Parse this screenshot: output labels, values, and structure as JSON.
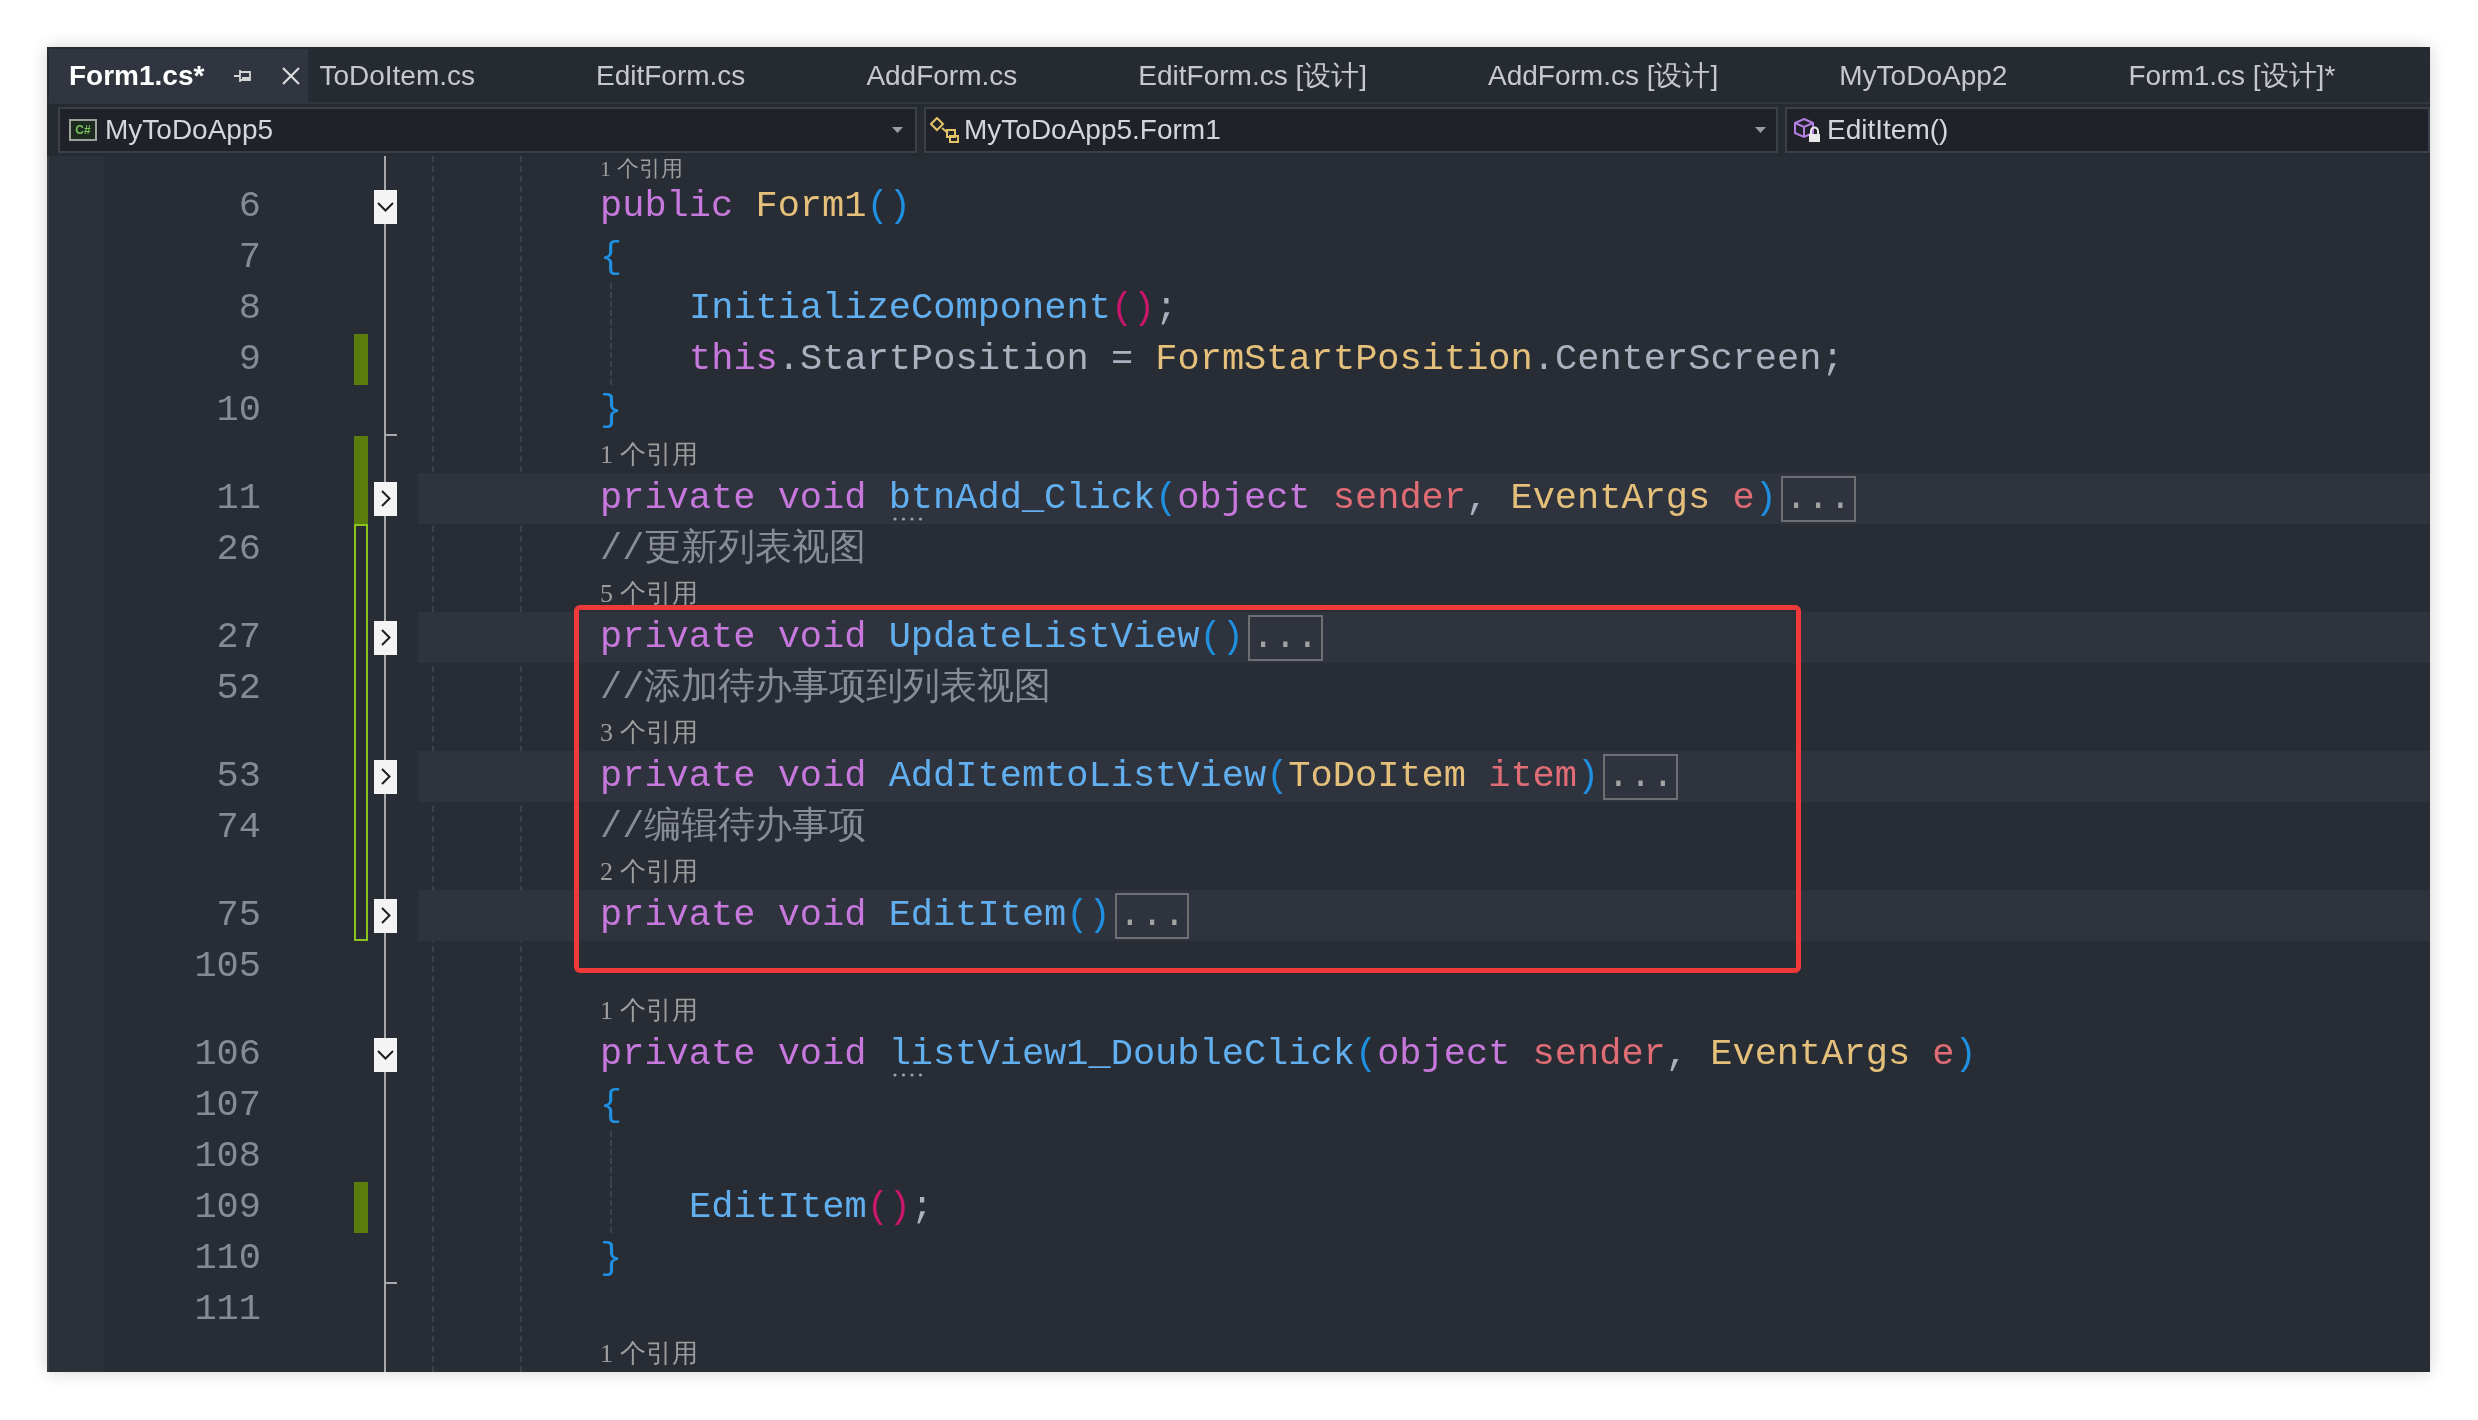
{
  "tabs": [
    {
      "label": "Form1.cs*",
      "selected": true
    },
    {
      "label": "ToDoItem.cs",
      "selected": false
    },
    {
      "label": "EditForm.cs",
      "selected": false
    },
    {
      "label": "AddForm.cs",
      "selected": false
    },
    {
      "label": "EditForm.cs [设计]",
      "selected": false
    },
    {
      "label": "AddForm.cs [设计]",
      "selected": false
    },
    {
      "label": "MyToDoApp2",
      "selected": false
    },
    {
      "label": "Form1.cs [设计]*",
      "selected": false
    }
  ],
  "navigation": [
    {
      "kind": "project",
      "badge": "C#",
      "label": "MyToDoApp5"
    },
    {
      "kind": "class",
      "label": "MyToDoApp5.Form1"
    },
    {
      "kind": "member",
      "label": "EditItem()"
    }
  ],
  "lines": [
    {
      "kind": "lens",
      "text": "1 个引用"
    },
    {
      "kind": "code",
      "number": "6",
      "expanded": true,
      "tokens": [
        {
          "kind": "keyword",
          "text": "public "
        },
        {
          "kind": "type",
          "text": "Form1"
        },
        {
          "kind": "bracket",
          "text": "()"
        }
      ]
    },
    {
      "kind": "code",
      "number": "7",
      "tokens": [
        {
          "kind": "bracket",
          "text": "{"
        }
      ]
    },
    {
      "kind": "code",
      "number": "8",
      "indented": true,
      "tokens": [
        {
          "kind": "method",
          "text": "InitializeComponent"
        },
        {
          "kind": "bracket2",
          "text": "()"
        },
        {
          "kind": "plain",
          "text": ";"
        }
      ]
    },
    {
      "kind": "code",
      "number": "9",
      "indented": true,
      "changed": true,
      "tokens": [
        {
          "kind": "keyword",
          "text": "this"
        },
        {
          "kind": "plain",
          "text": ".StartPosition = "
        },
        {
          "kind": "type",
          "text": "FormStartPosition"
        },
        {
          "kind": "plain",
          "text": ".CenterScreen;"
        }
      ]
    },
    {
      "kind": "code",
      "number": "10",
      "fold_end": true,
      "tokens": [
        {
          "kind": "bracket",
          "text": "}"
        }
      ]
    },
    {
      "kind": "lens",
      "text": "1 个引用",
      "changed": true
    },
    {
      "kind": "code",
      "number": "11",
      "expanded": false,
      "changed": true,
      "tokens": [
        {
          "kind": "keyword",
          "text": "private void "
        },
        {
          "kind": "method",
          "text": "btnAdd_Click",
          "hint": true
        },
        {
          "kind": "bracket",
          "text": "("
        },
        {
          "kind": "keyword",
          "text": "object "
        },
        {
          "kind": "param",
          "text": "sender"
        },
        {
          "kind": "plain",
          "text": ", "
        },
        {
          "kind": "type",
          "text": "EventArgs "
        },
        {
          "kind": "param",
          "text": "e"
        },
        {
          "kind": "bracket",
          "text": ")"
        },
        {
          "kind": "ellipsis",
          "text": "..."
        }
      ]
    },
    {
      "kind": "code",
      "number": "26",
      "outlined_change": true,
      "tokens": [
        {
          "kind": "comment",
          "text": "//更新列表视图"
        }
      ]
    },
    {
      "kind": "lens",
      "text": "5 个引用",
      "outlined_change": true
    },
    {
      "kind": "annotation",
      "lines": [
        {
          "kind": "code",
          "number": "27",
          "expanded": false,
          "outlined_change": true,
          "tokens": [
            {
              "kind": "keyword",
              "text": "private void "
            },
            {
              "kind": "method",
              "text": "UpdateListView"
            },
            {
              "kind": "bracket",
              "text": "()"
            },
            {
              "kind": "ellipsis",
              "text": "..."
            }
          ]
        },
        {
          "kind": "code",
          "number": "52",
          "outlined_change": true,
          "tokens": [
            {
              "kind": "comment",
              "text": "//添加待办事项到列表视图"
            }
          ]
        },
        {
          "kind": "lens",
          "text": "3 个引用",
          "outlined_change": true
        },
        {
          "kind": "code",
          "number": "53",
          "expanded": false,
          "outlined_change": true,
          "tokens": [
            {
              "kind": "keyword",
              "text": "private void "
            },
            {
              "kind": "method",
              "text": "AddItemtoListView"
            },
            {
              "kind": "bracket",
              "text": "("
            },
            {
              "kind": "type",
              "text": "ToDoItem "
            },
            {
              "kind": "param",
              "text": "item"
            },
            {
              "kind": "bracket",
              "text": ")"
            },
            {
              "kind": "ellipsis",
              "text": "..."
            }
          ]
        },
        {
          "kind": "code",
          "number": "74",
          "outlined_change": true,
          "tokens": [
            {
              "kind": "comment",
              "text": "//编辑待办事项"
            }
          ]
        },
        {
          "kind": "lens",
          "text": "2 个引用",
          "outlined_change": true
        },
        {
          "kind": "code",
          "number": "75",
          "expanded": false,
          "outlined_change": true,
          "tokens": [
            {
              "kind": "keyword",
              "text": "private void "
            },
            {
              "kind": "method",
              "text": "EditItem"
            },
            {
              "kind": "bracket",
              "text": "()"
            },
            {
              "kind": "ellipsis",
              "text": "..."
            }
          ]
        }
      ]
    },
    {
      "kind": "code",
      "number": "105"
    },
    {
      "kind": "lens",
      "text": "1 个引用"
    },
    {
      "kind": "code",
      "number": "106",
      "expanded": true,
      "tokens": [
        {
          "kind": "keyword",
          "text": "private void "
        },
        {
          "kind": "method",
          "text": "listView1_DoubleClick",
          "hint": true
        },
        {
          "kind": "bracket",
          "text": "("
        },
        {
          "kind": "keyword",
          "text": "object "
        },
        {
          "kind": "param",
          "text": "sender"
        },
        {
          "kind": "plain",
          "text": ", "
        },
        {
          "kind": "type",
          "text": "EventArgs "
        },
        {
          "kind": "param",
          "text": "e"
        },
        {
          "kind": "bracket",
          "text": ")"
        }
      ]
    },
    {
      "kind": "code",
      "number": "107",
      "tokens": [
        {
          "kind": "bracket",
          "text": "{"
        }
      ]
    },
    {
      "kind": "code",
      "number": "108",
      "indented": true
    },
    {
      "kind": "code",
      "number": "109",
      "indented": true,
      "changed": true,
      "tokens": [
        {
          "kind": "method",
          "text": "EditItem"
        },
        {
          "kind": "bracket2",
          "text": "()"
        },
        {
          "kind": "plain",
          "text": ";"
        }
      ]
    },
    {
      "kind": "code",
      "number": "110",
      "fold_end": true,
      "tokens": [
        {
          "kind": "bracket",
          "text": "}"
        }
      ]
    },
    {
      "kind": "code",
      "number": "111"
    },
    {
      "kind": "lens",
      "text": "1 个引用"
    }
  ]
}
